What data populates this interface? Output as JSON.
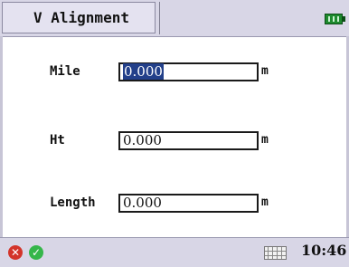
{
  "window": {
    "title": "V Alignment"
  },
  "form": {
    "mile": {
      "label": "Mile",
      "value": "0.000",
      "unit": "m"
    },
    "ht": {
      "label": "Ht",
      "value": "0.000",
      "unit": "m"
    },
    "length": {
      "label": "Length",
      "value": "0.000",
      "unit": "m"
    }
  },
  "status": {
    "time": "10:46"
  },
  "colors": {
    "battery": "#1e8a2e",
    "cancel": "#d3342a",
    "ok": "#35b64a",
    "selection": "#23408a"
  },
  "icons": {
    "battery": "battery-icon",
    "cancel": "cancel-icon",
    "ok": "ok-icon",
    "keyboard": "keyboard-icon"
  }
}
